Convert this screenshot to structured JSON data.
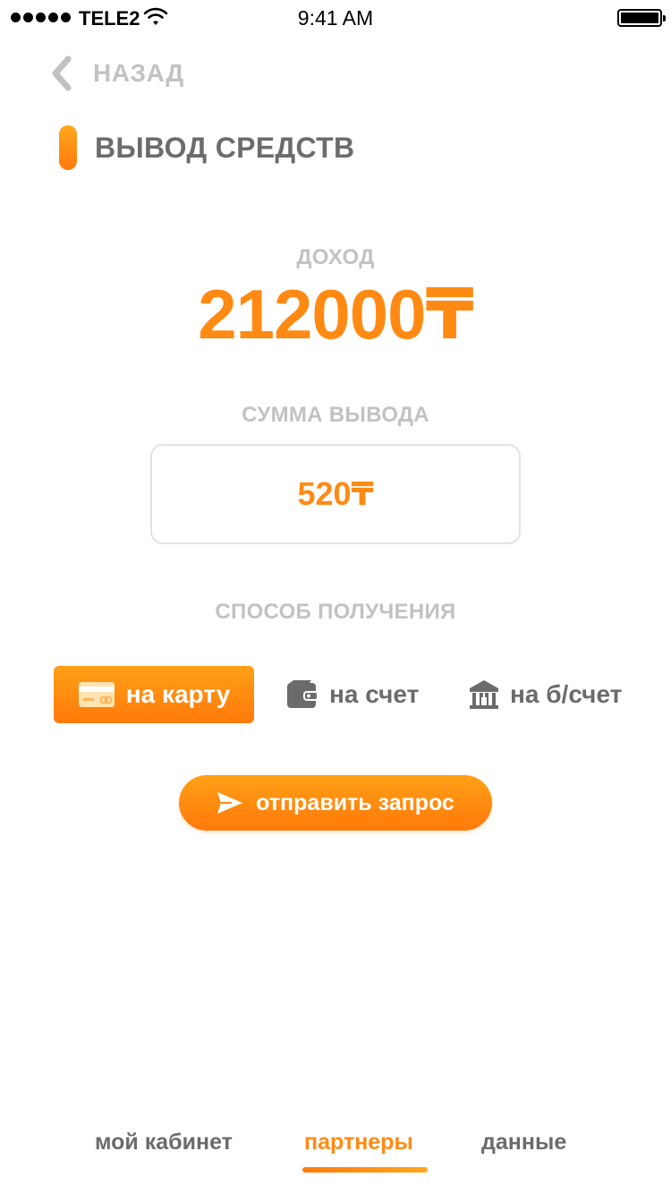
{
  "status_bar": {
    "carrier": "TELE2",
    "time": "9:41 AM"
  },
  "header": {
    "back_label": "НАЗАД",
    "title": "ВЫВОД СРЕДСТВ"
  },
  "income": {
    "label": "ДОХОД",
    "value": "212000₸"
  },
  "withdrawal": {
    "label": "СУММА ВЫВОДА",
    "amount": "520₸"
  },
  "methods": {
    "label": "СПОСОБ ПОЛУЧЕНИЯ",
    "items": [
      {
        "label": "на карту",
        "icon": "credit-card-icon",
        "active": true
      },
      {
        "label": "на счет",
        "icon": "wallet-icon",
        "active": false
      },
      {
        "label": "на б/счет",
        "icon": "bank-icon",
        "active": false
      }
    ]
  },
  "submit": {
    "label": "отправить запрос",
    "icon": "send-icon"
  },
  "bottom_nav": {
    "items": [
      {
        "label": "мой кабинет",
        "active": false
      },
      {
        "label": "партнеры",
        "active": true
      },
      {
        "label": "данные",
        "active": false
      }
    ]
  },
  "colors": {
    "accent": "#ff8a13",
    "accent_light": "#ffa71c",
    "muted_text": "#c2c2c2",
    "body_text": "#6b6b6b"
  }
}
